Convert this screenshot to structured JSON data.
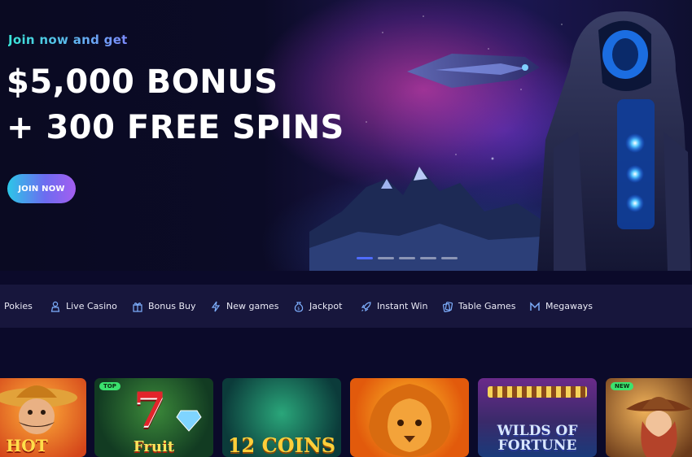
{
  "hero": {
    "subtitle": "Join now and get",
    "headline_line1": "$5,000 BONUS",
    "headline_line2": "+ 300 FREE SPINS",
    "cta_label": "JOIN NOW",
    "carousel": {
      "slide_count": 5,
      "active_index": 0
    }
  },
  "categories": [
    {
      "label": "Pokies",
      "icon": "none"
    },
    {
      "label": "Live Casino",
      "icon": "dealer-icon"
    },
    {
      "label": "Bonus Buy",
      "icon": "gift-icon"
    },
    {
      "label": "New games",
      "icon": "lightning-icon"
    },
    {
      "label": "Jackpot",
      "icon": "money-bag-icon"
    },
    {
      "label": "Instant Win",
      "icon": "rocket-icon"
    },
    {
      "label": "Table Games",
      "icon": "cards-icon"
    },
    {
      "label": "Megaways",
      "icon": "m-icon"
    }
  ],
  "games": [
    {
      "title": "HOT",
      "badge": ""
    },
    {
      "title": "Fruit",
      "badge": "TOP"
    },
    {
      "title": "12 COINS",
      "badge": ""
    },
    {
      "title": "",
      "badge": ""
    },
    {
      "title": "WILDS OF FORTUNE",
      "badge": ""
    },
    {
      "title": "",
      "badge": "NEW"
    }
  ],
  "colors": {
    "background": "#0b0a2a",
    "category_bar": "#17163c",
    "cta_gradient_start": "#2cc7e8",
    "cta_gradient_end": "#a45ef0",
    "accent_blue": "#4f6cff",
    "badge_green": "#3be36e"
  }
}
